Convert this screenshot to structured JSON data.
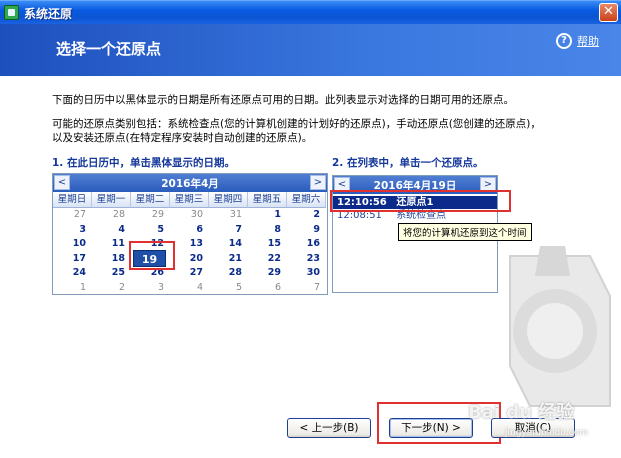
{
  "window": {
    "title": "系统还原",
    "close_glyph": "✕"
  },
  "header": {
    "title": "选择一个还原点",
    "help_label": "帮助",
    "help_glyph": "?"
  },
  "description": {
    "line1": "下面的日历中以黑体显示的日期是所有还原点可用的日期。此列表显示对选择的日期可用的还原点。",
    "line2": "可能的还原点类别包括：系统检查点(您的计算机创建的计划好的还原点)，手动还原点(您创建的还原点)，",
    "line3": "以及安装还原点(在特定程序安装时自动创建的还原点)。"
  },
  "steps": {
    "step1": "1. 在此日历中，单击黑体显示的日期。",
    "step2": "2. 在列表中，单击一个还原点。"
  },
  "calendar": {
    "month_label": "2016年4月",
    "prev_glyph": "<",
    "next_glyph": ">",
    "weekdays": [
      "星期日",
      "星期一",
      "星期二",
      "星期三",
      "星期四",
      "星期五",
      "星期六"
    ],
    "weeks": [
      [
        "27",
        "28",
        "29",
        "30",
        "31",
        "1",
        "2"
      ],
      [
        "3",
        "4",
        "5",
        "6",
        "7",
        "8",
        "9"
      ],
      [
        "10",
        "11",
        "12",
        "13",
        "14",
        "15",
        "16"
      ],
      [
        "17",
        "18",
        "19",
        "20",
        "21",
        "22",
        "23"
      ],
      [
        "24",
        "25",
        "26",
        "27",
        "28",
        "29",
        "30"
      ],
      [
        "1",
        "2",
        "3",
        "4",
        "5",
        "6",
        "7"
      ]
    ],
    "selected_day": "19"
  },
  "restore_points": {
    "date_label": "2016年4月19日",
    "prev_glyph": "<",
    "next_glyph": ">",
    "items": [
      {
        "time": "12:10:56",
        "name": "还原点1"
      },
      {
        "time": "12:08:51",
        "name": "系统检查点"
      }
    ],
    "tooltip": "将您的计算机还原到这个时间"
  },
  "buttons": {
    "back": "< 上一步(B)",
    "next": "下一步(N) >",
    "cancel": "取消(C)"
  },
  "watermark": {
    "brand": "Bai du 经验",
    "sub": "jingyan.baidu.com"
  },
  "colors": {
    "title_bar": "#0b55d4",
    "header_band": "#3a77df",
    "selection": "#0b2a8a",
    "annotation_red": "#e03030",
    "heading_blue": "#14379a"
  },
  "icons": {
    "app": "system-restore-icon",
    "help": "help-icon",
    "close": "close-icon"
  }
}
